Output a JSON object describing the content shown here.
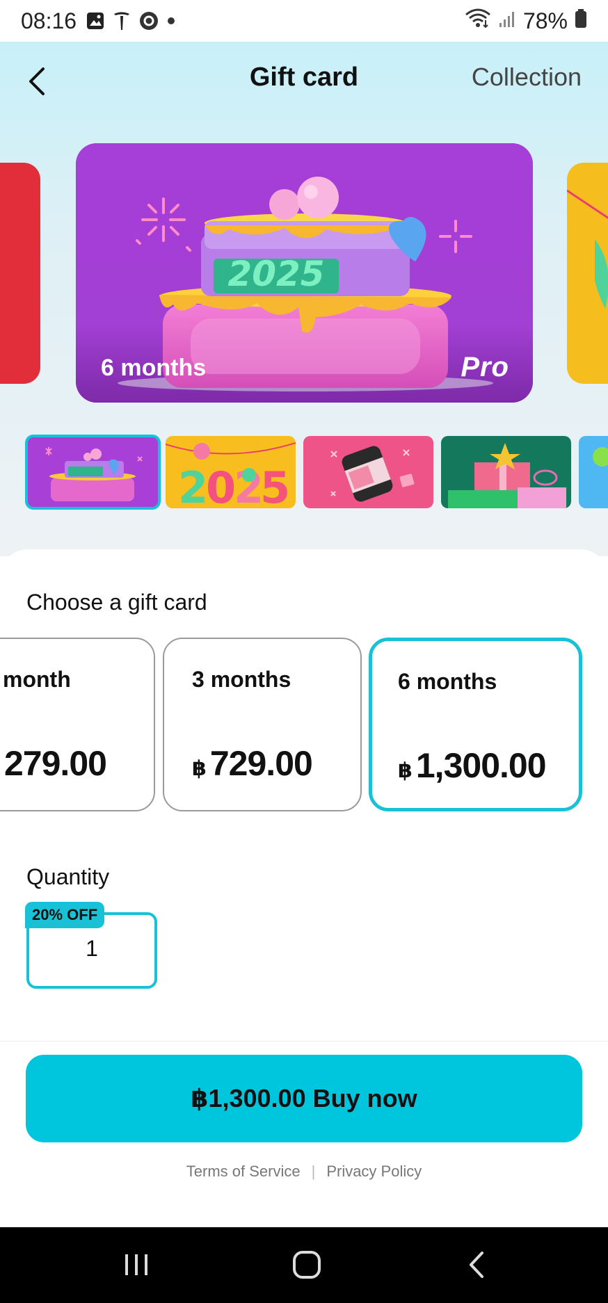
{
  "status_bar": {
    "time": "08:16",
    "battery": "78%",
    "icons": [
      "gallery-icon",
      "tesla-icon",
      "record-icon",
      "dot-icon",
      "wifi-icon",
      "signal-icon",
      "battery-icon"
    ]
  },
  "header": {
    "title": "Gift card",
    "collection_label": "Collection"
  },
  "carousel": {
    "current_card": {
      "label": "6 months",
      "brand": "Pro",
      "cake_text": "2025"
    },
    "thumbnails": [
      {
        "theme": "cake-2025",
        "color": "#a83fd7",
        "selected": true
      },
      {
        "theme": "2025-balloons",
        "color": "#f8be1f",
        "selected": false
      },
      {
        "theme": "happy-can",
        "color": "#ee5487",
        "selected": false
      },
      {
        "theme": "gift-boxes",
        "color": "#13785c",
        "selected": false
      },
      {
        "theme": "blue-card",
        "color": "#4fb7f2",
        "selected": false
      }
    ]
  },
  "choose": {
    "title": "Choose a gift card",
    "options": [
      {
        "name": "month",
        "currency": "",
        "price": "279.00",
        "selected": false
      },
      {
        "name": "3 months",
        "currency": "฿",
        "price": "729.00",
        "selected": false
      },
      {
        "name": "6 months",
        "currency": "฿",
        "price": "1,300.00",
        "selected": true
      }
    ]
  },
  "quantity": {
    "title": "Quantity",
    "badge": "20% OFF",
    "value": "1"
  },
  "buy": {
    "label": "฿1,300.00 Buy now"
  },
  "legal": {
    "terms": "Terms of Service",
    "separator": "|",
    "privacy": "Privacy Policy"
  },
  "colors": {
    "accent": "#00c6dd",
    "selected_border": "#18c1d6",
    "hero_card": "#a83fd7"
  }
}
